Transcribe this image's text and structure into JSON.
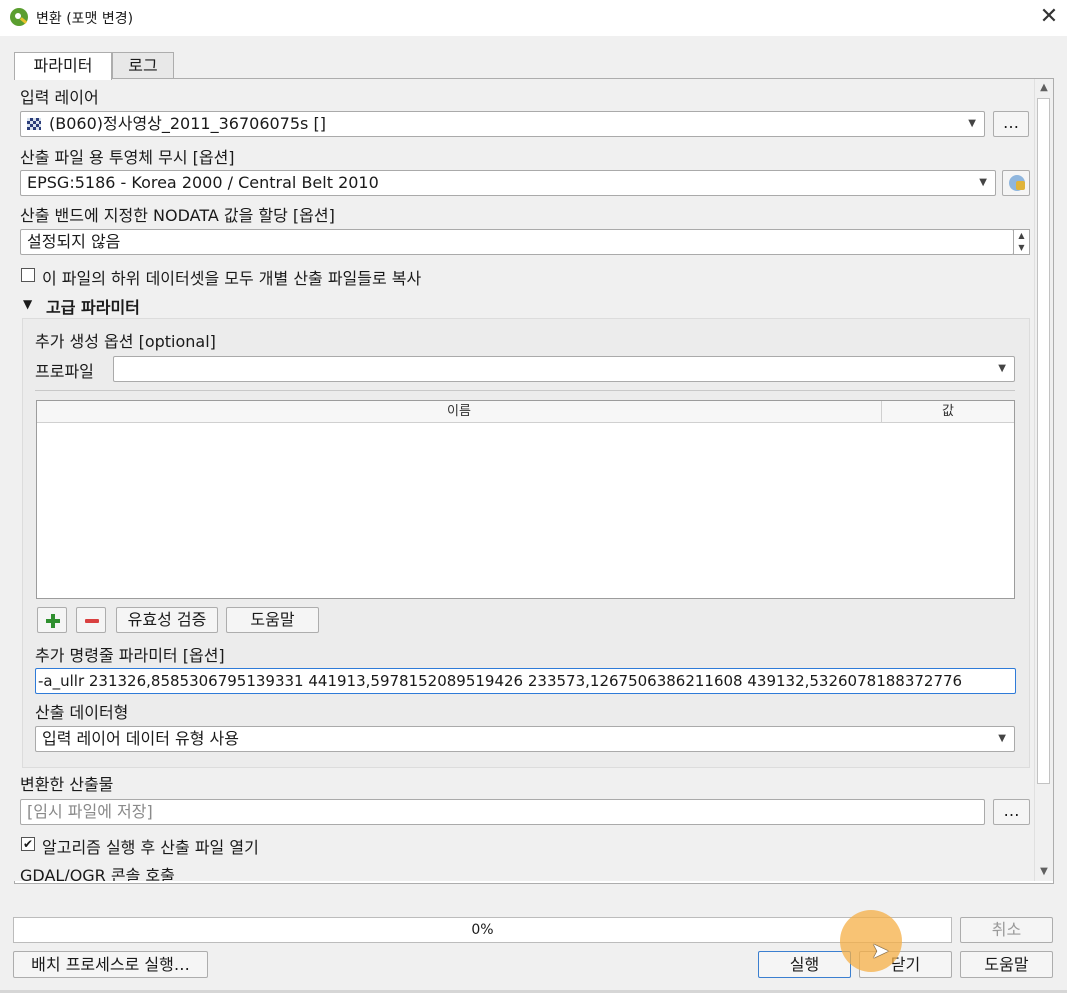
{
  "window": {
    "title": "변환 (포맷 변경)"
  },
  "tabs": [
    {
      "label": "파라미터"
    },
    {
      "label": "로그"
    }
  ],
  "params": {
    "input_layer": {
      "label": "입력 레이어",
      "value": "(B060)정사영상_2011_36706075s []",
      "browse": "…"
    },
    "target_crs": {
      "label": "산출 파일 용 투영체 무시 [옵션]",
      "value": "EPSG:5186 - Korea 2000 / Central Belt 2010"
    },
    "nodata": {
      "label": "산출 밴드에 지정한 NODATA 값을 할당 [옵션]",
      "value": "설정되지 않음"
    },
    "copy_subdatasets": {
      "label": "이 파일의 하위 데이터셋을 모두 개별 산출 파일들로 복사",
      "checked": false
    }
  },
  "advanced": {
    "header": "고급 파라미터",
    "extra_creation": {
      "label": "추가 생성 옵션 [optional]",
      "profile_label": "프로파일",
      "profile_value": ""
    },
    "table": {
      "columns": [
        "이름",
        "값"
      ],
      "rows": []
    },
    "buttons": {
      "add": "+",
      "remove": "−",
      "validate": "유효성 검증",
      "help": "도움말"
    },
    "extra_cmd": {
      "label": "추가 명령줄 파라미터 [옵션]",
      "value": "-a_ullr 231326,8585306795139331 441913,5978152089519426 233573,1267506386211608 439132,5326078188372776"
    },
    "output_datatype": {
      "label": "산출 데이터형",
      "value": "입력 레이어 데이터 유형 사용"
    }
  },
  "output": {
    "label": "변환한 산출물",
    "placeholder": "[임시 파일에 저장]",
    "browse": "…",
    "open_after": {
      "label": "알고리즘 실행 후 산출 파일 열기",
      "checked": true
    },
    "console_label": "GDAL/OGR 콘솔 호출"
  },
  "footer": {
    "progress": {
      "text": "0%",
      "value": 0
    },
    "cancel": "취소",
    "batch": "배치 프로세스로 실행…",
    "run": "실행",
    "close": "닫기",
    "help": "도움말"
  }
}
